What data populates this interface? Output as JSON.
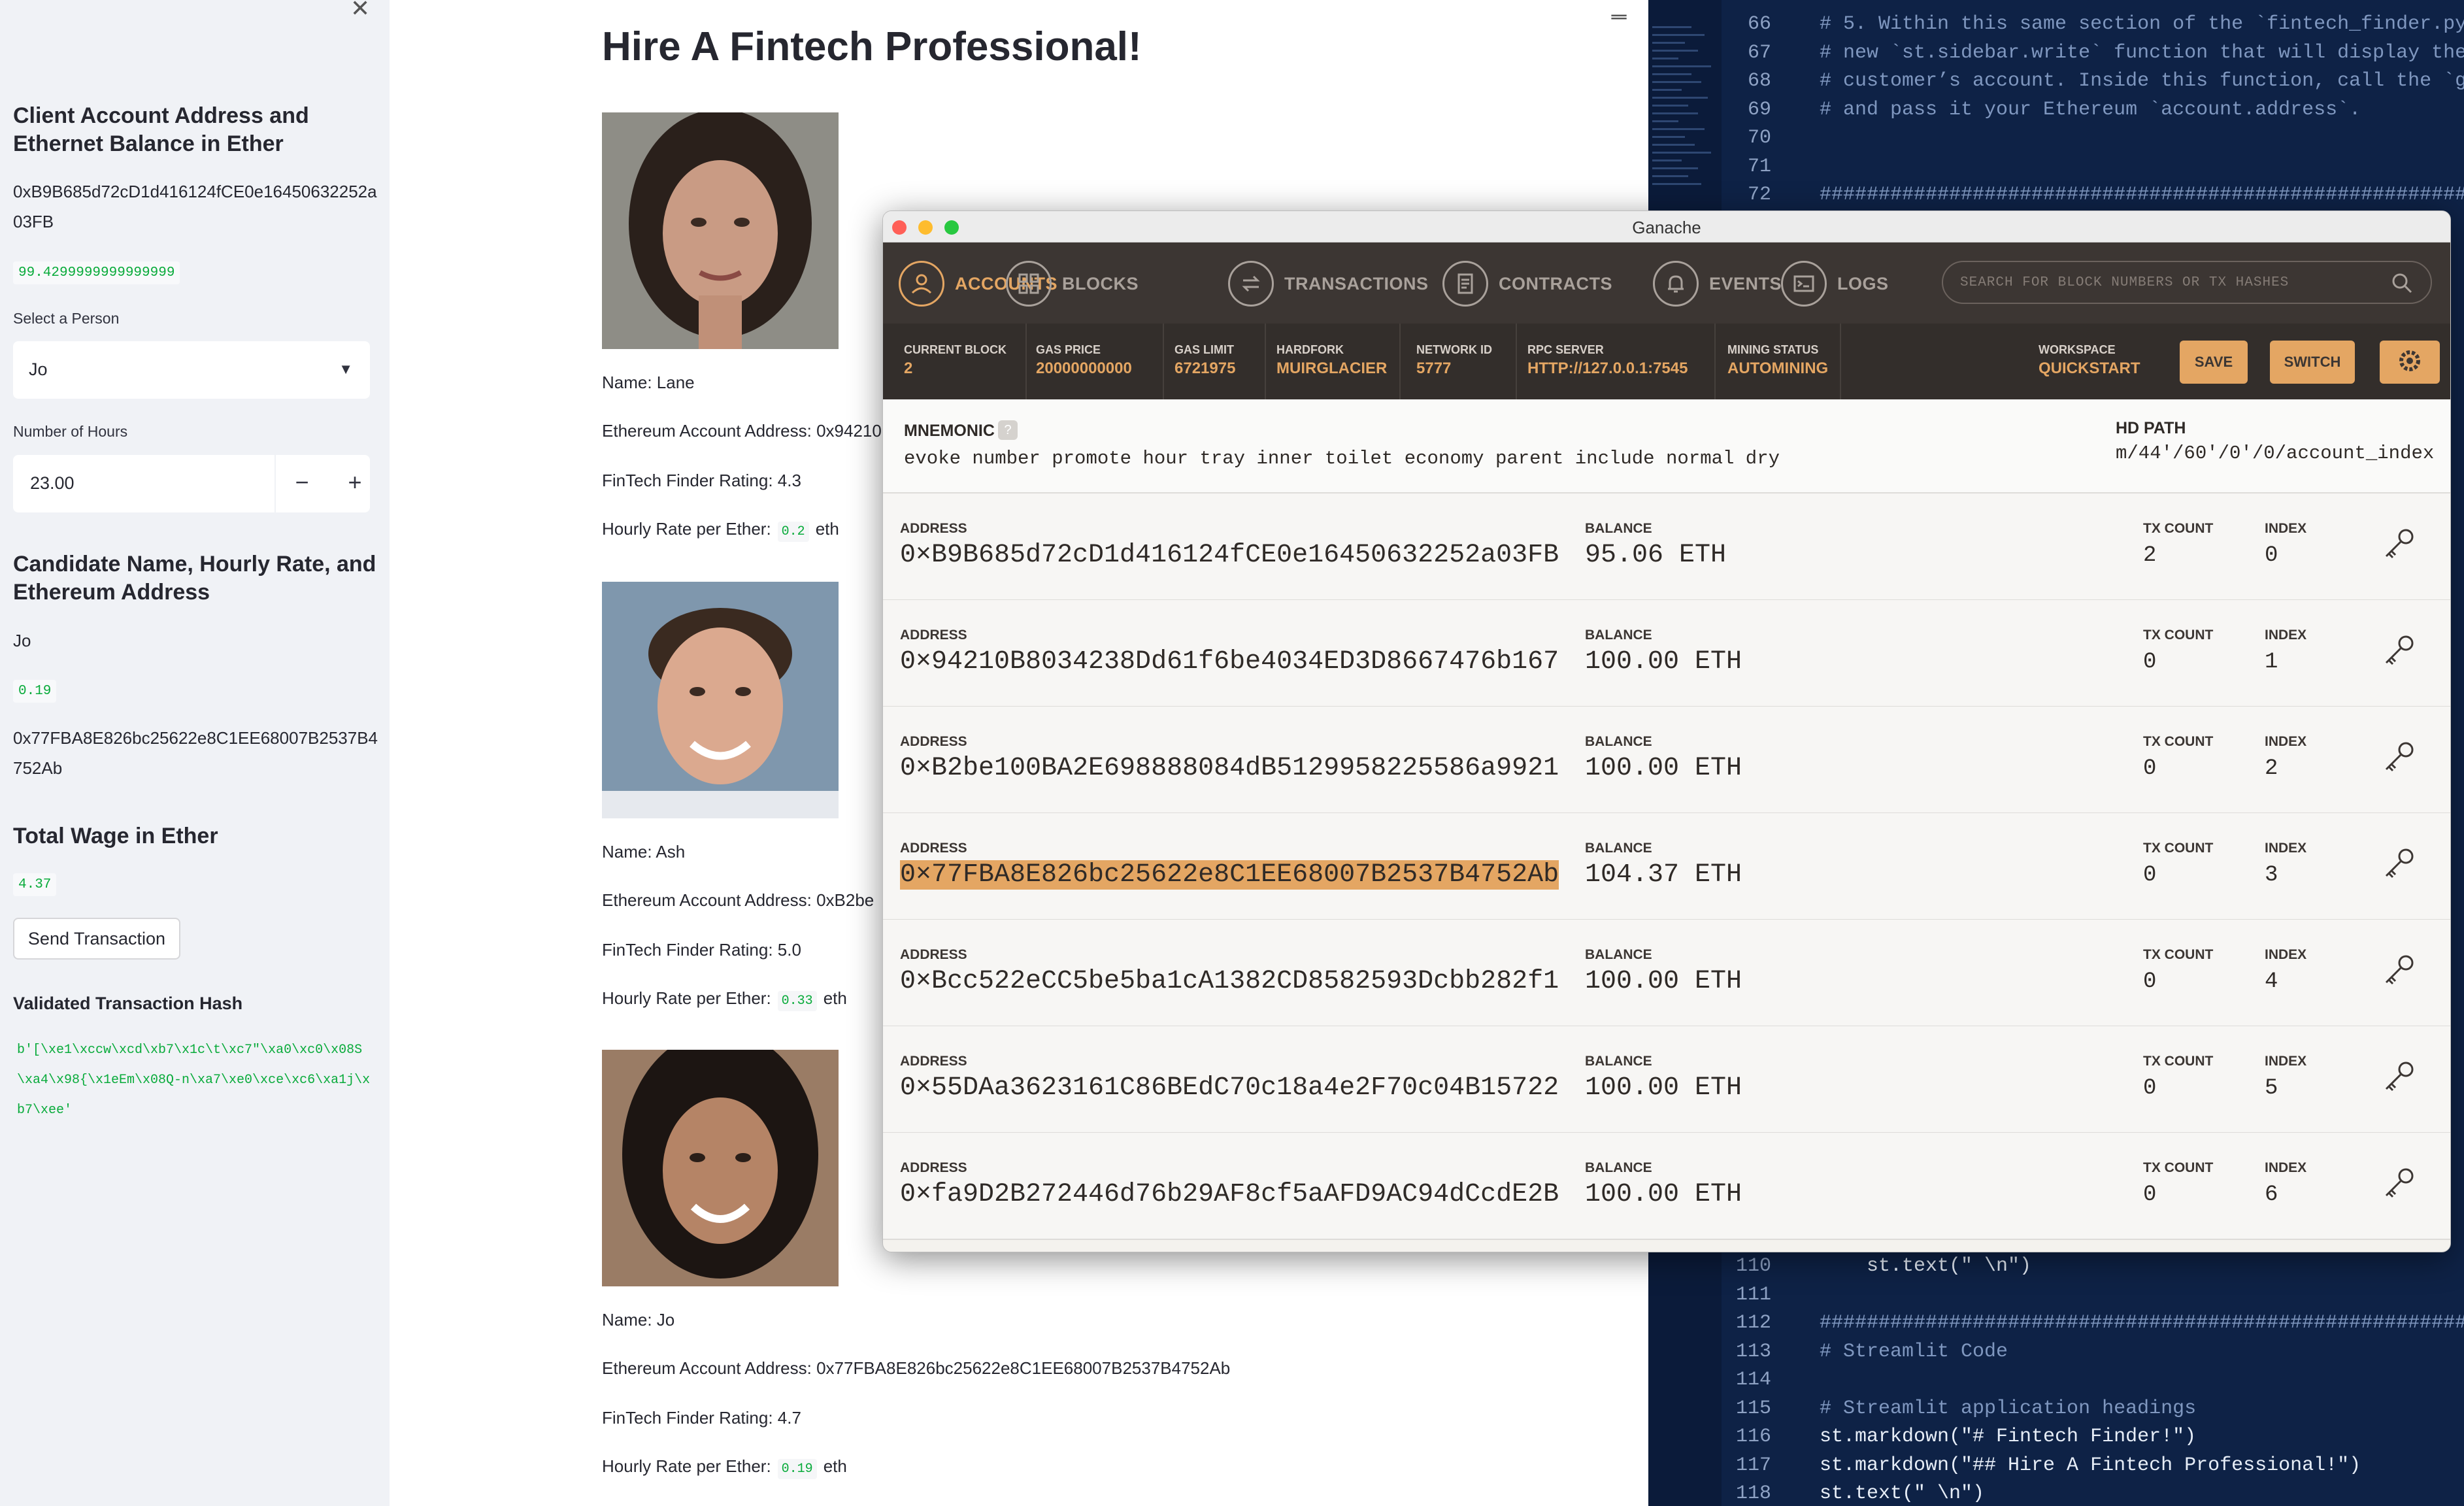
{
  "sidebar": {
    "close_icon": "close-icon",
    "client_heading": "Client Account Address and Ethernet Balance in Ether",
    "client_address": "0xB9B685d72cD1d416124fCE0e16450632252a03FB",
    "client_balance": "99.4299999999999999",
    "select_label": "Select a Person",
    "select_value": "Jo",
    "hours_label": "Number of Hours",
    "hours_value": "23.00",
    "candidate_heading": "Candidate Name, Hourly Rate, and Ethereum Address",
    "candidate_name": "Jo",
    "candidate_rate": "0.19",
    "candidate_address": "0x77FBA8E826bc25622e8C1EE68007B2537B4752Ab",
    "wage_heading": "Total Wage in Ether",
    "wage_value": "4.37",
    "send_button": "Send Transaction",
    "hash_heading": "Validated Transaction Hash",
    "hash_value": "b'[\\xe1\\xccw\\xcd\\xb7\\x1c\\t\\xc7\"\\xa0\\xc0\\x08S\\xa4\\x98{\\x1eEm\\x08Q-n\\xa7\\xe0\\xce\\xc6\\xa1j\\xb7\\xee'"
  },
  "main": {
    "title": "Hire A Fintech Professional!",
    "candidates": [
      {
        "name": "Name: Lane",
        "address": "Ethereum Account Address: 0x94210",
        "rating": "FinTech Finder Rating: 4.3",
        "rate_label": "Hourly Rate per Ether:",
        "rate": "0.2",
        "unit": "eth"
      },
      {
        "name": "Name: Ash",
        "address": "Ethereum Account Address: 0xB2be",
        "rating": "FinTech Finder Rating: 5.0",
        "rate_label": "Hourly Rate per Ether:",
        "rate": "0.33",
        "unit": "eth"
      },
      {
        "name": "Name: Jo",
        "address": "Ethereum Account Address: 0x77FBA8E826bc25622e8C1EE68007B2537B4752Ab",
        "rating": "FinTech Finder Rating: 4.7",
        "rate_label": "Hourly Rate per Ether:",
        "rate": "0.19",
        "unit": "eth"
      }
    ]
  },
  "editor": {
    "top_lines": [
      {
        "n": "66",
        "t": "# 5. Within this same section of the `fintech_finder.py`"
      },
      {
        "n": "67",
        "t": "# new `st.sidebar.write` function that will display the b"
      },
      {
        "n": "68",
        "t": "# customer’s account. Inside this function, call the `get"
      },
      {
        "n": "69",
        "t": "# and pass it your Ethereum `account.address`."
      },
      {
        "n": "70",
        "t": ""
      },
      {
        "n": "71",
        "t": ""
      },
      {
        "n": "72",
        "t": "##########################################################"
      }
    ],
    "bottom_lines": [
      {
        "n": "110",
        "t": "    st.text(\" \\n\")"
      },
      {
        "n": "111",
        "t": ""
      },
      {
        "n": "112",
        "t": "##########################################################"
      },
      {
        "n": "113",
        "t": "# Streamlit Code"
      },
      {
        "n": "114",
        "t": ""
      },
      {
        "n": "115",
        "t": "# Streamlit application headings"
      },
      {
        "n": "116",
        "t": "st.markdown(\"# Fintech Finder!\")"
      },
      {
        "n": "117",
        "t": "st.markdown(\"## Hire A Fintech Professional!\")"
      },
      {
        "n": "118",
        "t": "st.text(\" \\n\")"
      }
    ]
  },
  "ganache": {
    "window_title": "Ganache",
    "nav": [
      {
        "label": "ACCOUNTS",
        "icon": "accounts-icon"
      },
      {
        "label": "BLOCKS",
        "icon": "blocks-icon"
      },
      {
        "label": "TRANSACTIONS",
        "icon": "transactions-icon"
      },
      {
        "label": "CONTRACTS",
        "icon": "contracts-icon"
      },
      {
        "label": "EVENTS",
        "icon": "events-icon"
      },
      {
        "label": "LOGS",
        "icon": "logs-icon"
      }
    ],
    "search_placeholder": "SEARCH FOR BLOCK NUMBERS OR TX HASHES",
    "stats": [
      {
        "k": "CURRENT BLOCK",
        "v": "2"
      },
      {
        "k": "GAS PRICE",
        "v": "20000000000"
      },
      {
        "k": "GAS LIMIT",
        "v": "6721975"
      },
      {
        "k": "HARDFORK",
        "v": "MUIRGLACIER"
      },
      {
        "k": "NETWORK ID",
        "v": "5777"
      },
      {
        "k": "RPC SERVER",
        "v": "HTTP://127.0.0.1:7545"
      },
      {
        "k": "MINING STATUS",
        "v": "AUTOMINING"
      },
      {
        "k": "WORKSPACE",
        "v": "QUICKSTART"
      }
    ],
    "save_button": "SAVE",
    "switch_button": "SWITCH",
    "mnemonic_label": "MNEMONIC",
    "mnemonic_help": "?",
    "mnemonic": "evoke number promote hour tray inner toilet economy parent include normal dry",
    "hd_path_label": "HD PATH",
    "hd_path": "m/44'/60'/0'/0/account_index",
    "labels": {
      "address": "ADDRESS",
      "balance": "BALANCE",
      "tx_count": "TX COUNT",
      "index": "INDEX"
    },
    "accounts": [
      {
        "address": "0×B9B685d72cD1d416124fCE0e16450632252a03FB",
        "balance": "95.06 ETH",
        "tx": "2",
        "index": "0"
      },
      {
        "address": "0×94210B8034238Dd61f6be4034ED3D8667476b167",
        "balance": "100.00 ETH",
        "tx": "0",
        "index": "1"
      },
      {
        "address": "0×B2be100BA2E698888084dB5129958225586a9921",
        "balance": "100.00 ETH",
        "tx": "0",
        "index": "2"
      },
      {
        "address": "0×77FBA8E826bc25622e8C1EE68007B2537B4752Ab",
        "balance": "104.37 ETH",
        "tx": "0",
        "index": "3"
      },
      {
        "address": "0×Bcc522eCC5be5ba1cA1382CD8582593Dcbb282f1",
        "balance": "100.00 ETH",
        "tx": "0",
        "index": "4"
      },
      {
        "address": "0×55DAa3623161C86BEdC70c18a4e2F70c04B15722",
        "balance": "100.00 ETH",
        "tx": "0",
        "index": "5"
      },
      {
        "address": "0×fa9D2B272446d76b29AF8cf5aAFD9AC94dCcdE2B",
        "balance": "100.00 ETH",
        "tx": "0",
        "index": "6"
      }
    ],
    "highlight_color": "#e4a663"
  }
}
